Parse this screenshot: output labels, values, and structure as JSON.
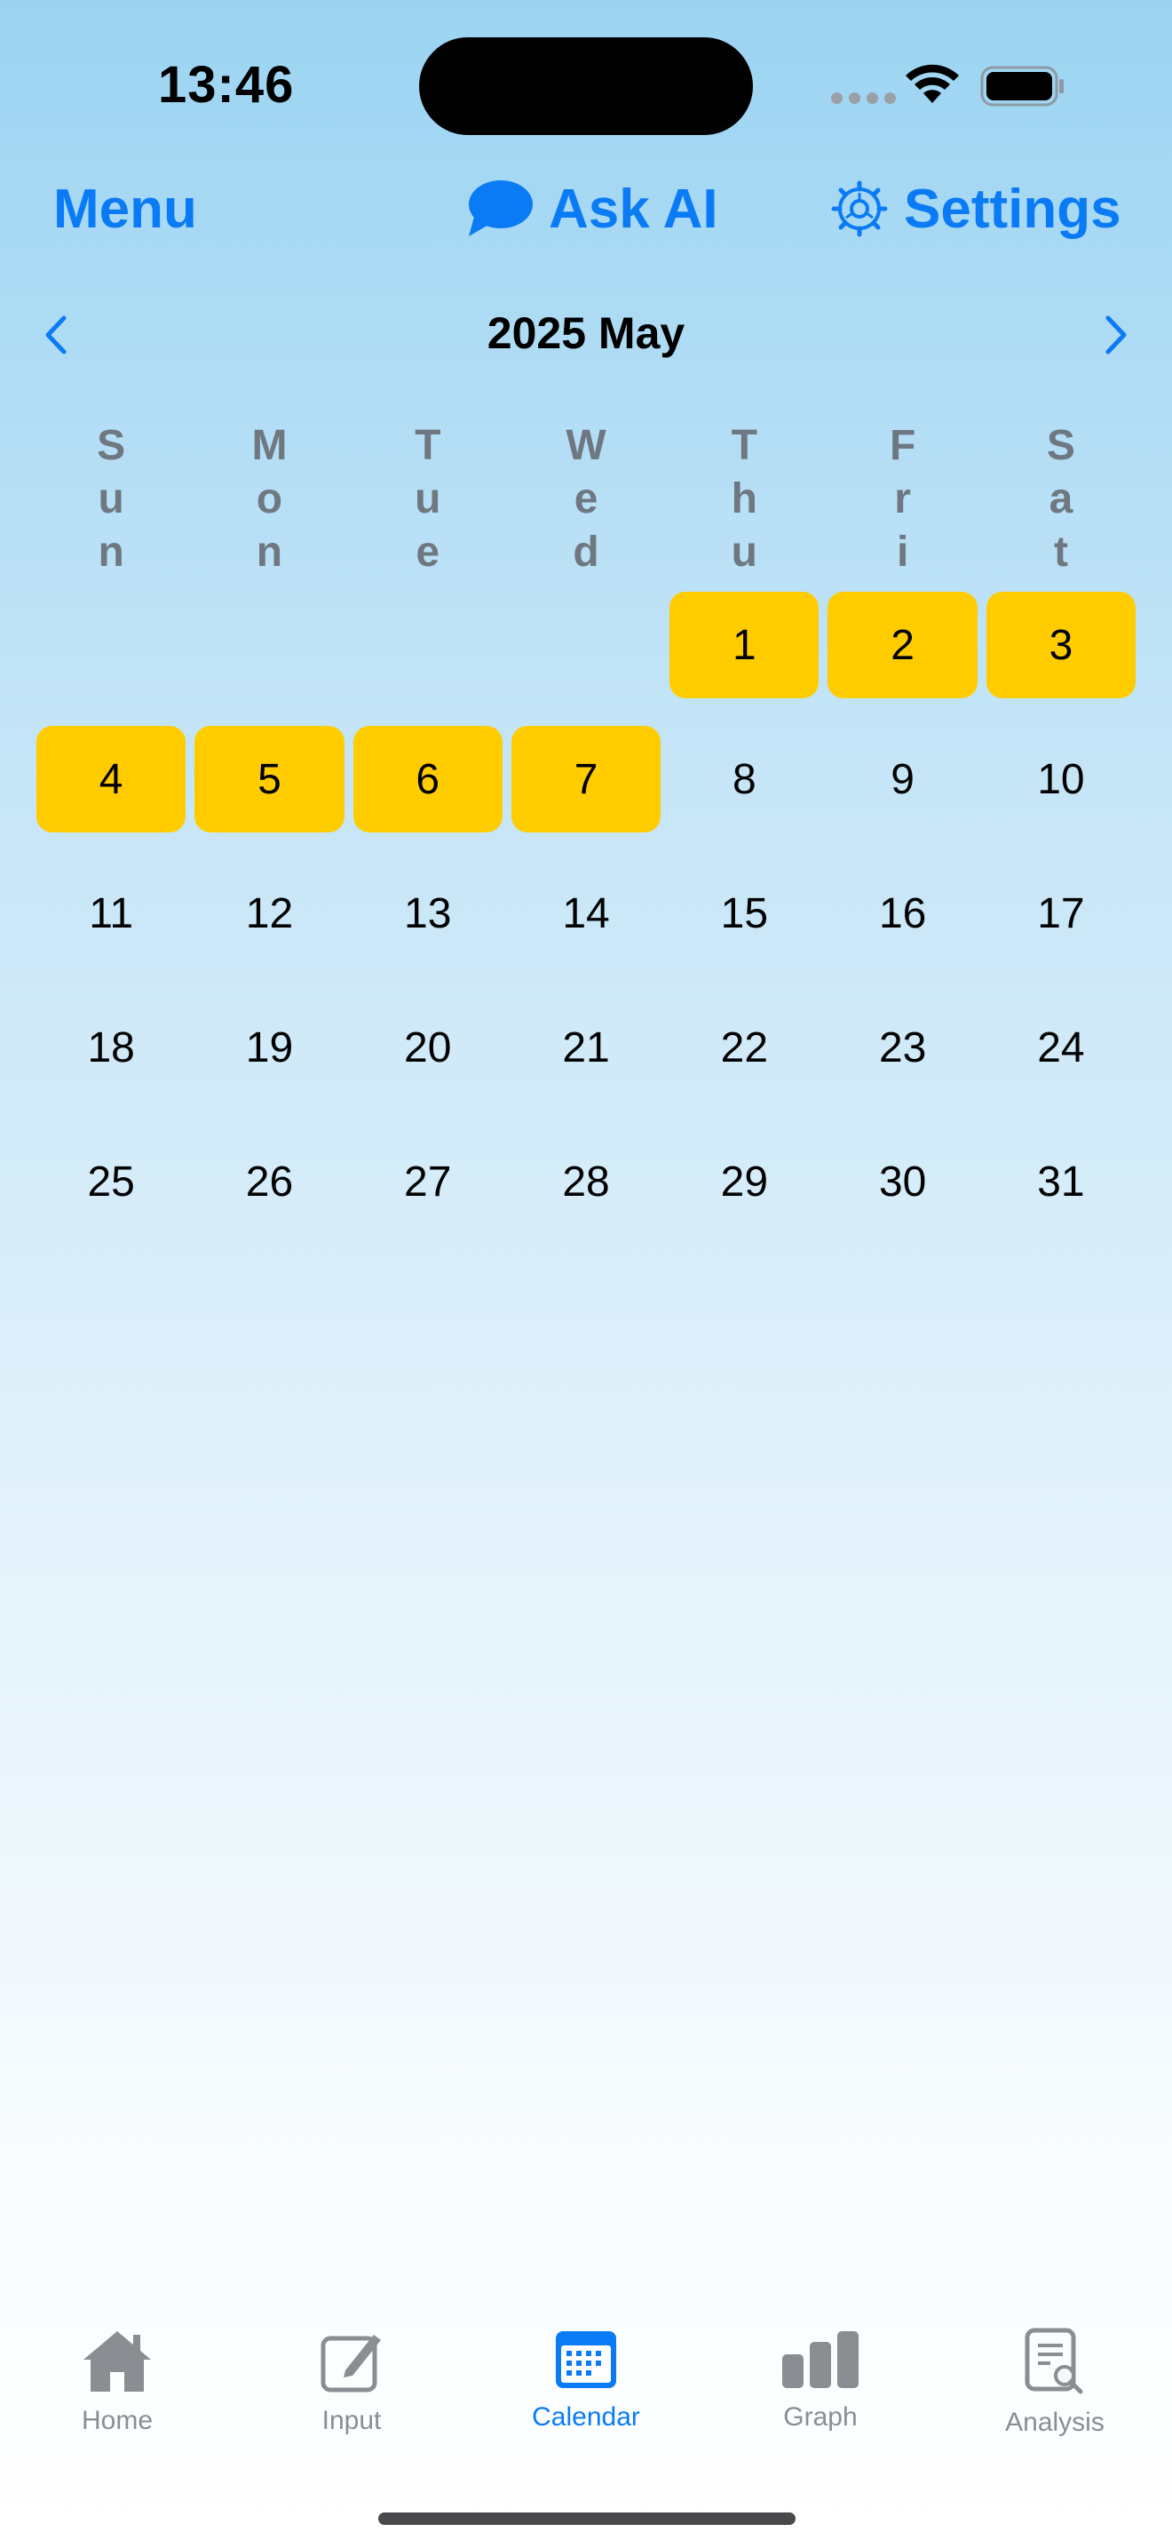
{
  "status": {
    "time": "13:46"
  },
  "header": {
    "menu_label": "Menu",
    "ask_label": "Ask AI",
    "settings_label": "Settings",
    "accent": "#0a7bf5"
  },
  "calendar": {
    "title": "2025 May",
    "weekdays": [
      "Sun",
      "Mon",
      "Tue",
      "Wed",
      "Thu",
      "Fri",
      "Sat"
    ],
    "leading_blanks": 4,
    "days": [
      "1",
      "2",
      "3",
      "4",
      "5",
      "6",
      "7",
      "8",
      "9",
      "10",
      "11",
      "12",
      "13",
      "14",
      "15",
      "16",
      "17",
      "18",
      "19",
      "20",
      "21",
      "22",
      "23",
      "24",
      "25",
      "26",
      "27",
      "28",
      "29",
      "30",
      "31"
    ],
    "highlighted_days": [
      "1",
      "2",
      "3",
      "4",
      "5",
      "6",
      "7"
    ],
    "highlight_color": "#ffcc00"
  },
  "tabs": [
    {
      "label": "Home",
      "icon": "house-icon",
      "active": false
    },
    {
      "label": "Input",
      "icon": "edit-icon",
      "active": false
    },
    {
      "label": "Calendar",
      "icon": "calendar-icon",
      "active": true
    },
    {
      "label": "Graph",
      "icon": "bar-chart-icon",
      "active": false
    },
    {
      "label": "Analysis",
      "icon": "document-search-icon",
      "active": false
    }
  ]
}
